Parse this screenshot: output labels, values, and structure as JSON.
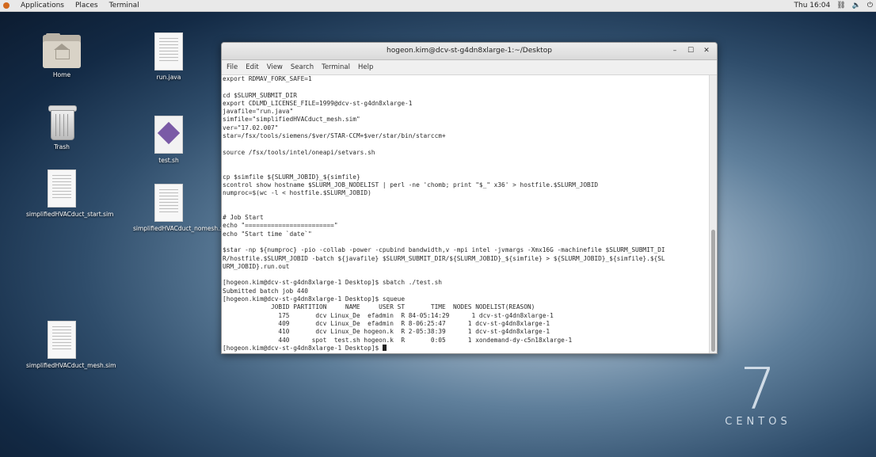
{
  "topbar": {
    "applications": "Applications",
    "places": "Places",
    "terminal": "Terminal",
    "clock": "Thu 16:04",
    "icons": [
      "network-icon",
      "volume-icon",
      "power-icon"
    ]
  },
  "desktop": {
    "icons": [
      {
        "label": "Home",
        "kind": "folder"
      },
      {
        "label": "run.java",
        "kind": "doc"
      },
      {
        "label": "Trash",
        "kind": "trash"
      },
      {
        "label": "test.sh",
        "kind": "script"
      },
      {
        "label": "simplifiedHVACduct_start.sim",
        "kind": "doc"
      },
      {
        "label": "simplifiedHVACduct_nomesh.sim",
        "kind": "doc"
      },
      {
        "label": "simplifiedHVACduct_mesh.sim",
        "kind": "doc"
      }
    ]
  },
  "logo": {
    "number": "7",
    "word": "CENTOS"
  },
  "window": {
    "title": "hogeon.kim@dcv-st-g4dn8xlarge-1:~/Desktop",
    "menus": [
      "File",
      "Edit",
      "View",
      "Search",
      "Terminal",
      "Help"
    ],
    "lines": [
      "export RDMAV_FORK_SAFE=1",
      "",
      "cd $SLURM_SUBMIT_DIR",
      "export CDLMD_LICENSE_FILE=1999@dcv-st-g4dn8xlarge-1",
      "javafile=\"run.java\"",
      "simfile=\"simplifiedHVACduct_mesh.sim\"",
      "ver=\"17.02.007\"",
      "star=/fsx/tools/siemens/$ver/STAR-CCM+$ver/star/bin/starccm+",
      "",
      "source /fsx/tools/intel/oneapi/setvars.sh",
      "",
      "",
      "cp $simfile ${SLURM_JOBID}_${simfile}",
      "scontrol show hostname $SLURM_JOB_NODELIST | perl -ne 'chomb; print \"$_\" x36' > hostfile.$SLURM_JOBID",
      "numproc=$(wc -l < hostfile.$SLURM_JOBID)",
      "",
      "",
      "# Job Start",
      "echo \"========================\"",
      "echo \"Start time `date`\"",
      "",
      "$star -np ${numproc} -pio -collab -power -cpubind bandwidth,v -mpi intel -jvmargs -Xmx16G -machinefile $SLURM_SUBMIT_DI",
      "R/hostfile.$SLURM_JOBID -batch ${javafile} $SLURM_SUBMIT_DIR/${SLURM_JOBID}_${simfile} > ${SLURM_JOBID}_${simfile}.${SL",
      "URM_JOBID}.run.out",
      "",
      "[hogeon.kim@dcv-st-g4dn8xlarge-1 Desktop]$ sbatch ./test.sh",
      "Submitted batch job 440",
      "[hogeon.kim@dcv-st-g4dn8xlarge-1 Desktop]$ squeue",
      "             JOBID PARTITION     NAME     USER ST       TIME  NODES NODELIST(REASON)",
      "               175       dcv Linux_De  efadmin  R 84-05:14:29      1 dcv-st-g4dn8xlarge-1",
      "               409       dcv Linux_De  efadmin  R 8-06:25:47      1 dcv-st-g4dn8xlarge-1",
      "               410       dcv Linux_De hogeon.k  R 2-05:38:39      1 dcv-st-g4dn8xlarge-1",
      "               440      spot  test.sh hogeon.k  R       0:05      1 xondemand-dy-c5n18xlarge-1"
    ],
    "prompt": "[hogeon.kim@dcv-st-g4dn8xlarge-1 Desktop]$ "
  }
}
